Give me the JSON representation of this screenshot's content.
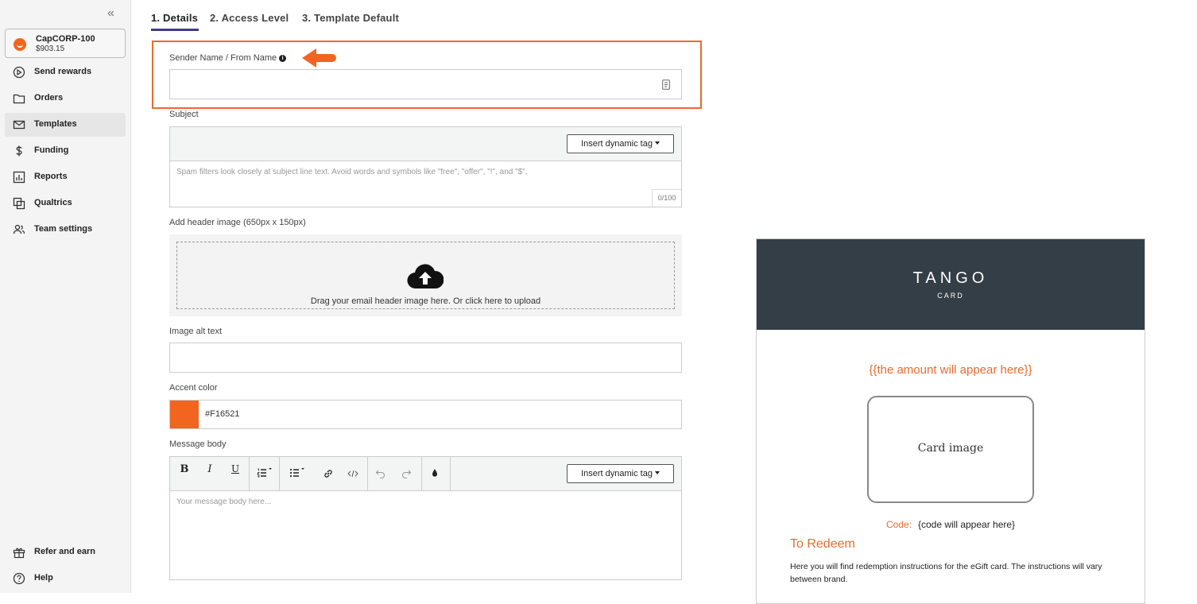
{
  "sidebar": {
    "collapse_glyph": "«",
    "account": {
      "name": "CapCORP-100",
      "balance": "$903.15"
    },
    "items": [
      {
        "label": "Send rewards",
        "icon": "send-icon"
      },
      {
        "label": "Orders",
        "icon": "folder-icon"
      },
      {
        "label": "Templates",
        "icon": "mail-icon",
        "active": true
      },
      {
        "label": "Funding",
        "icon": "dollar-icon"
      },
      {
        "label": "Reports",
        "icon": "report-icon"
      },
      {
        "label": "Qualtrics",
        "icon": "qualtrics-icon"
      },
      {
        "label": "Team settings",
        "icon": "team-icon"
      }
    ],
    "bottom_items": [
      {
        "label": "Refer and earn",
        "icon": "gift-icon"
      },
      {
        "label": "Help",
        "icon": "help-icon"
      }
    ]
  },
  "tabs": [
    {
      "label": "1. Details",
      "active": true
    },
    {
      "label": "2. Access Level"
    },
    {
      "label": "3. Template Default"
    }
  ],
  "form": {
    "sender_label": "Sender Name / From Name",
    "sender_value": "",
    "subject_label": "Subject",
    "insert_tag_label": "Insert dynamic tag",
    "subject_placeholder": "Spam filters look closely at subject line text. Avoid words and symbols like \"free\", \"offer\", \"!\", and \"$\".",
    "subject_counter": "0/100",
    "header_image_label": "Add header image (650px x 150px)",
    "upload_text": "Drag your email header image here. Or click here to upload",
    "alt_text_label": "Image alt text",
    "alt_text_value": "",
    "accent_label": "Accent color",
    "accent_value": "#F16521",
    "message_label": "Message body",
    "message_placeholder": "Your message body here...",
    "toolbar": {
      "bold": "B",
      "italic": "I",
      "underline": "U"
    }
  },
  "preview": {
    "logo_main": "TANGO",
    "logo_sub": "CARD",
    "amount": "{{the amount will appear here}}",
    "card_image": "Card image",
    "code_label": "Code:",
    "code_value": "{code will appear here}",
    "redeem_title": "To Redeem",
    "redeem_text": "Here you will find redemption instructions for the eGift card. The instructions will vary between brand."
  },
  "colors": {
    "accent": "#F16521",
    "highlight": "#EC6A2C",
    "preview_header": "#343E47",
    "tab_underline": "#3F3D8A"
  }
}
